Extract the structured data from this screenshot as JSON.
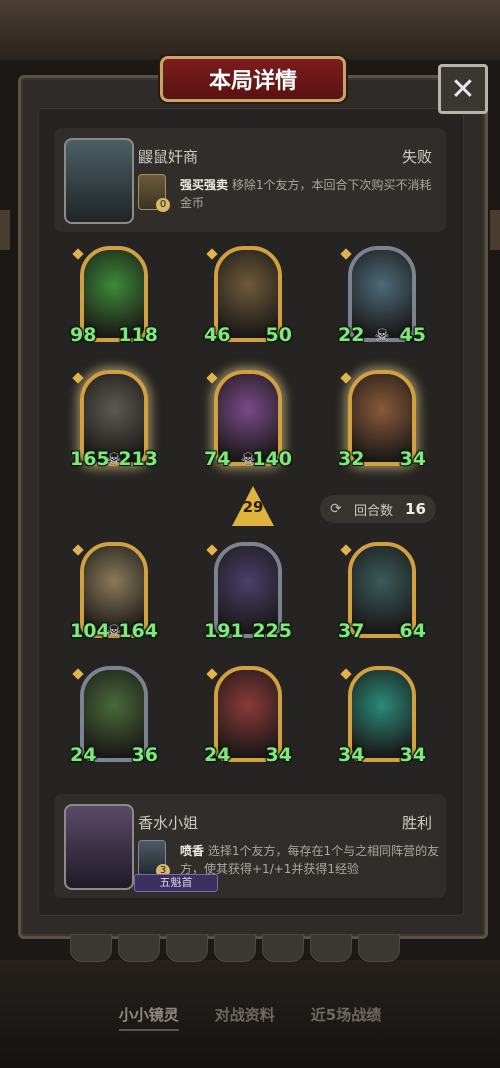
{
  "dialog": {
    "title": "本局详情",
    "close_icon": "close-icon"
  },
  "opponent": {
    "name": "鼹鼠奸商",
    "result": "失败",
    "skill": {
      "name": "强买强卖",
      "desc": "移除1个友方，本回合下次购买不消耗金币",
      "count": "0"
    }
  },
  "player": {
    "name": "香水小姐",
    "result": "胜利",
    "skill": {
      "name": "喷香",
      "desc": "选择1个友方，每存在1个与之相同阵营的友方，使其获得+1/+1并获得1经验",
      "count": "3"
    },
    "rank": "五魁首"
  },
  "enemy_board": [
    {
      "atk": "98",
      "hp": "118",
      "frame": "gold",
      "skull": false,
      "color": "#3e8a3a"
    },
    {
      "atk": "46",
      "hp": "50",
      "frame": "gold",
      "skull": false,
      "color": "#6e5a3a"
    },
    {
      "atk": "22",
      "hp": "45",
      "frame": "silver",
      "skull": true,
      "color": "#4d6a7a"
    },
    {
      "atk": "165",
      "hp": "213",
      "frame": "gold",
      "skull": true,
      "color": "#5d5a52"
    },
    {
      "atk": "74",
      "hp": "140",
      "frame": "gold",
      "skull": true,
      "color": "#7a4a8a"
    },
    {
      "atk": "32",
      "hp": "34",
      "frame": "gold",
      "skull": false,
      "color": "#8a5a3a"
    }
  ],
  "player_board": [
    {
      "atk": "104",
      "hp": "164",
      "frame": "gold",
      "skull": true,
      "color": "#8a7a5a"
    },
    {
      "atk": "191",
      "hp": "225",
      "frame": "silver",
      "skull": false,
      "color": "#4a3f6a"
    },
    {
      "atk": "37",
      "hp": "64",
      "frame": "gold",
      "skull": false,
      "color": "#3a5a5a"
    },
    {
      "atk": "24",
      "hp": "36",
      "frame": "silver",
      "skull": false,
      "color": "#4a6a3a"
    },
    {
      "atk": "24",
      "hp": "34",
      "frame": "gold",
      "skull": false,
      "color": "#8a3a3a"
    },
    {
      "atk": "34",
      "hp": "34",
      "frame": "gold",
      "skull": false,
      "color": "#2a8a7a"
    }
  ],
  "battle": {
    "damage": "29",
    "turns_label": "回合数",
    "turns_value": "16"
  },
  "tabs": [
    "小小镜灵",
    "对战资料",
    "近5场战绩"
  ]
}
